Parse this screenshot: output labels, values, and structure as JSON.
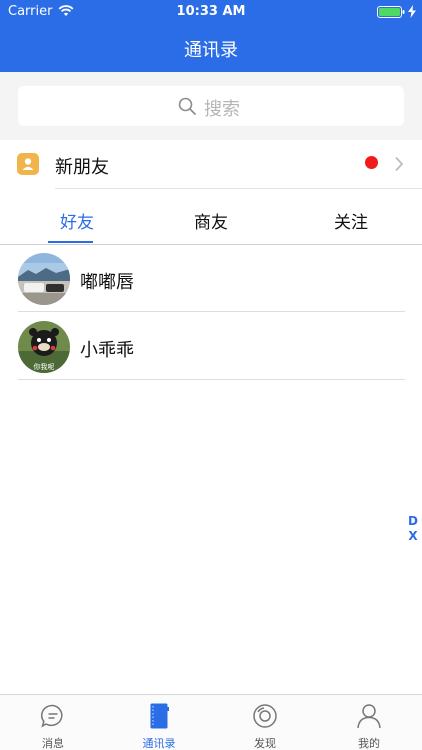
{
  "status_bar": {
    "carrier": "Carrier",
    "time": "10:33 AM"
  },
  "nav": {
    "title": "通讯录"
  },
  "search": {
    "placeholder": "搜索",
    "icon": "search-icon"
  },
  "new_friend": {
    "label": "新朋友",
    "has_badge": true,
    "icon": "contact-card-icon"
  },
  "tabs": [
    {
      "label": "好友",
      "active": true
    },
    {
      "label": "商友",
      "active": false
    },
    {
      "label": "关注",
      "active": false
    }
  ],
  "contacts": [
    {
      "name": "嘟嘟唇"
    },
    {
      "name": "小乖乖",
      "avatar_caption": "你我呢"
    }
  ],
  "side_badge": {
    "line1": "D",
    "line2": "X"
  },
  "tabbar": [
    {
      "label": "消息",
      "icon": "message-bubble-icon",
      "active": false
    },
    {
      "label": "通讯录",
      "icon": "address-book-icon",
      "active": true
    },
    {
      "label": "发现",
      "icon": "compass-icon",
      "active": false
    },
    {
      "label": "我的",
      "icon": "profile-icon",
      "active": false
    }
  ],
  "colors": {
    "primary": "#2b6de6",
    "badge_red": "#f21b1b",
    "new_friend_icon": "#f0b44a"
  }
}
